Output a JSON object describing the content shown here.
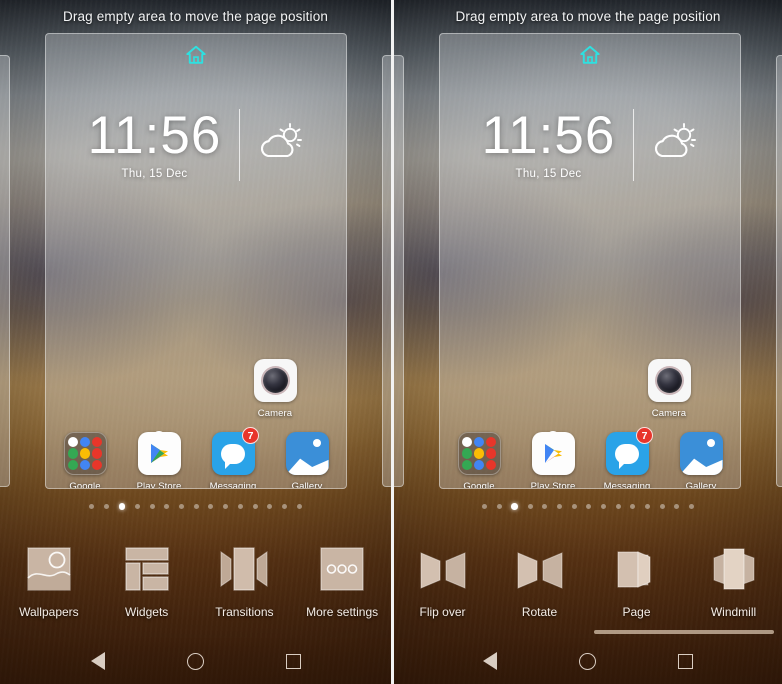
{
  "hint": "Drag empty area to move the page position",
  "colors": {
    "home_indicator": "#2ee0e0",
    "badge": "#e8352b",
    "active_dot": "#ffffff",
    "divider": "#f2f2f2",
    "toolbar_icon": "#c9b5a4"
  },
  "clock": {
    "time": "11:56",
    "date": "Thu, 15 Dec",
    "weather_icon": "partly-cloudy-icon"
  },
  "apps": {
    "camera_row": [
      {
        "label": "Camera",
        "icon": "camera-icon",
        "badge": null
      }
    ],
    "bottom_row": [
      {
        "label": "Google",
        "icon": "google-folder-icon",
        "badge": null
      },
      {
        "label": "Play Store",
        "icon": "play-store-icon",
        "badge": null
      },
      {
        "label": "Messaging",
        "icon": "messaging-icon",
        "badge": "7"
      },
      {
        "label": "Gallery",
        "icon": "gallery-icon",
        "badge": null
      }
    ]
  },
  "folder_icons": [
    "#ffffff",
    "#4285f4",
    "#e8362a",
    "#34a853",
    "#fbbc05",
    "#e8362a",
    "#34a853",
    "#4285f4",
    "#e8362a"
  ],
  "pager": {
    "total_dots": 15,
    "active_index": 2
  },
  "left_panel": {
    "toolbar": [
      {
        "label": "Wallpapers",
        "icon": "wallpapers-icon"
      },
      {
        "label": "Widgets",
        "icon": "widgets-icon"
      },
      {
        "label": "Transitions",
        "icon": "transitions-icon"
      },
      {
        "label": "More settings",
        "icon": "more-settings-icon"
      }
    ]
  },
  "right_panel": {
    "toolbar": [
      {
        "label": "Flip over",
        "icon": "flip-over-icon"
      },
      {
        "label": "Rotate",
        "icon": "rotate-icon"
      },
      {
        "label": "Page",
        "icon": "page-icon"
      },
      {
        "label": "Windmill",
        "icon": "windmill-icon"
      }
    ],
    "has_scrollbar": true
  },
  "navbar": {
    "back": "back-icon",
    "home": "home-icon",
    "recents": "recents-icon"
  }
}
